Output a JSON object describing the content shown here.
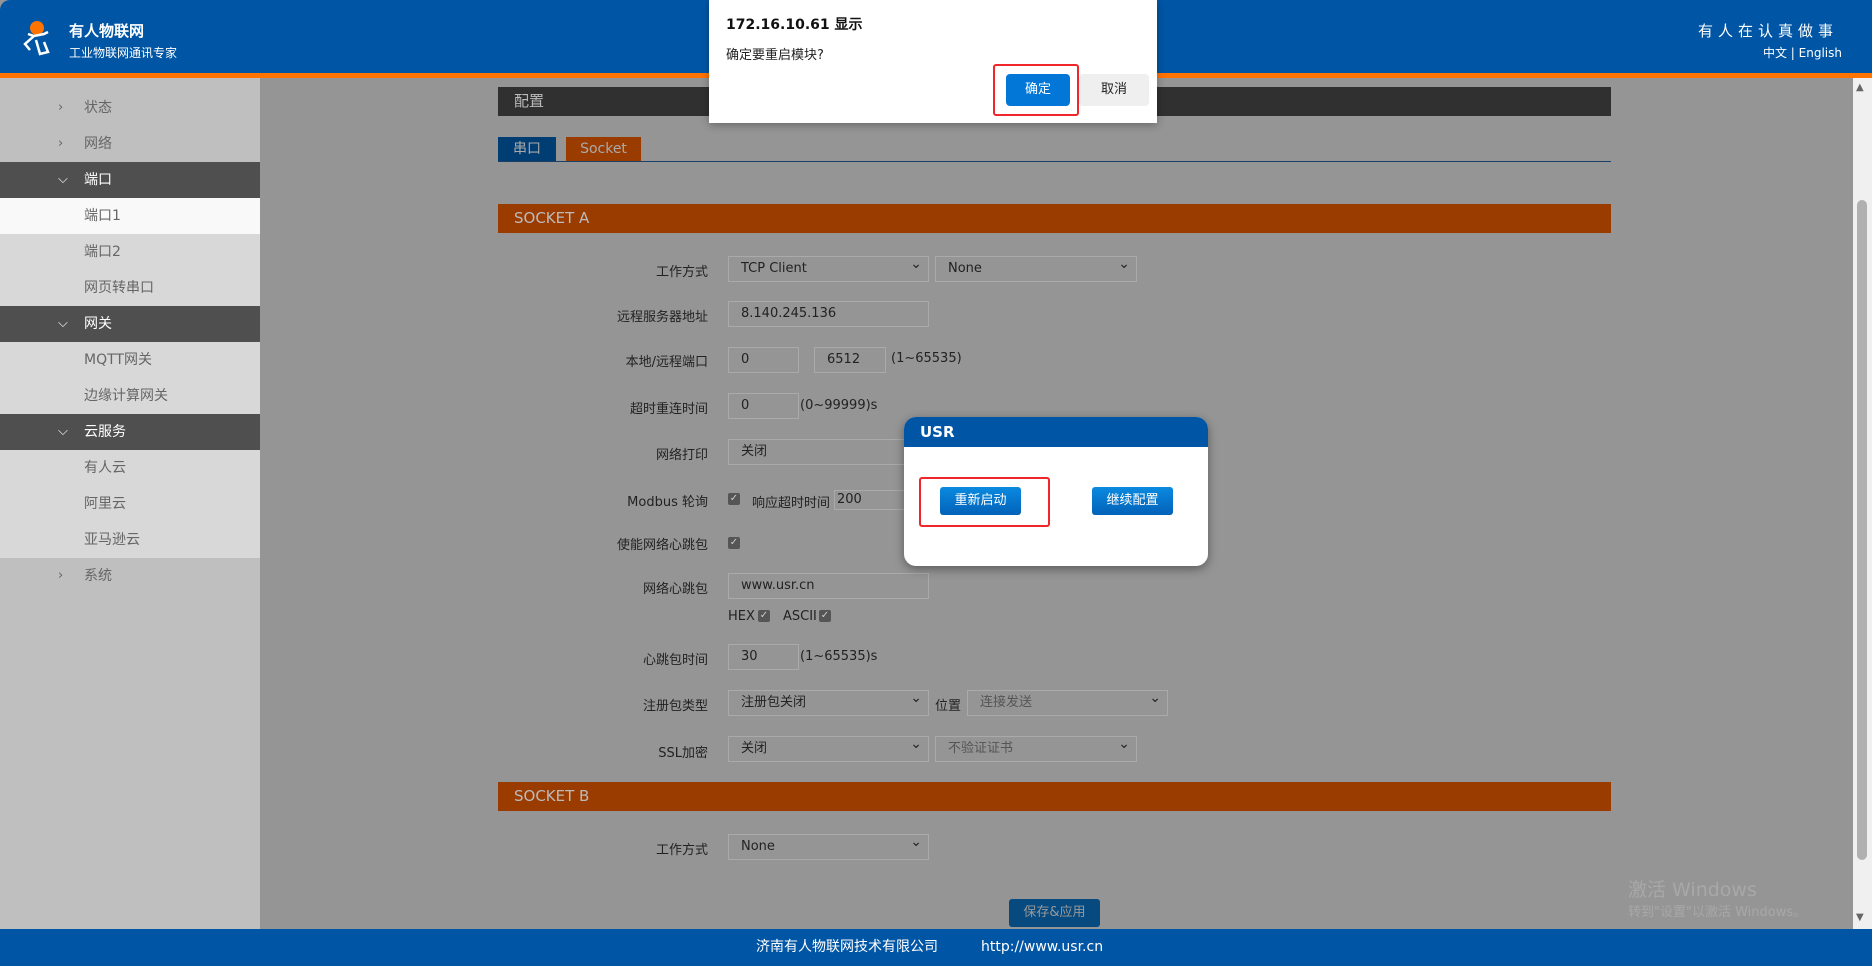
{
  "header": {
    "brand": "有人物联网",
    "subtitle": "工业物联网通讯专家",
    "slogan": "有人在认真做事",
    "lang_zh": "中文",
    "lang_sep": "|",
    "lang_en": "English"
  },
  "sidebar": [
    {
      "label": "状态",
      "type": "collapsed"
    },
    {
      "label": "网络",
      "type": "collapsed"
    },
    {
      "label": "端口",
      "type": "group"
    },
    {
      "label": "端口1",
      "type": "active"
    },
    {
      "label": "端口2",
      "type": "child"
    },
    {
      "label": "网页转串口",
      "type": "child"
    },
    {
      "label": "网关",
      "type": "group"
    },
    {
      "label": "MQTT网关",
      "type": "child"
    },
    {
      "label": "边缘计算网关",
      "type": "child"
    },
    {
      "label": "云服务",
      "type": "group"
    },
    {
      "label": "有人云",
      "type": "child"
    },
    {
      "label": "阿里云",
      "type": "child"
    },
    {
      "label": "亚马逊云",
      "type": "child"
    },
    {
      "label": "系统",
      "type": "collapsed"
    }
  ],
  "main": {
    "config_title": "配置",
    "tabs": [
      "串口",
      "Socket"
    ],
    "socket_a": {
      "title": "SOCKET A",
      "work_mode_label": "工作方式",
      "work_mode": "TCP Client",
      "work_mode2": "None",
      "server_label": "远程服务器地址",
      "server": "8.140.245.136",
      "port_label": "本地/远程端口",
      "local_port": "0",
      "remote_port": "6512",
      "port_range": "(1~65535)",
      "reconnect_label": "超时重连时间",
      "reconnect": "0",
      "reconnect_range": "(0~99999)s",
      "print_label": "网络打印",
      "print": "关闭",
      "modbus_label": "Modbus 轮询",
      "modbus_checked": true,
      "timeout_label": "响应超时时间",
      "timeout": "200",
      "heartbeat_enable_label": "使能网络心跳包",
      "heartbeat_enabled": true,
      "heartbeat_label": "网络心跳包",
      "heartbeat": "www.usr.cn",
      "hex_label": "HEX",
      "hex": true,
      "ascii_label": "ASCII",
      "ascii": true,
      "heartbeat_time_label": "心跳包时间",
      "heartbeat_time": "30",
      "heartbeat_time_range": "(1~65535)s",
      "reg_label": "注册包类型",
      "reg": "注册包关闭",
      "pos_label": "位置",
      "pos": "连接发送",
      "ssl_label": "SSL加密",
      "ssl": "关闭",
      "ssl_cert": "不验证证书"
    },
    "socket_b": {
      "title": "SOCKET B",
      "work_mode_label": "工作方式",
      "work_mode": "None"
    },
    "save_label": "保存&应用"
  },
  "footer": {
    "company": "济南有人物联网技术有限公司",
    "url": "http://www.usr.cn"
  },
  "watermark": {
    "line1": "激活 Windows",
    "line2": "转到\"设置\"以激活 Windows。"
  },
  "alert": {
    "title": "172.16.10.61 显示",
    "message": "确定要重启模块?",
    "ok": "确定",
    "cancel": "取消"
  },
  "usr_dialog": {
    "title": "USR",
    "restart": "重新启动",
    "continue": "继续配置"
  }
}
